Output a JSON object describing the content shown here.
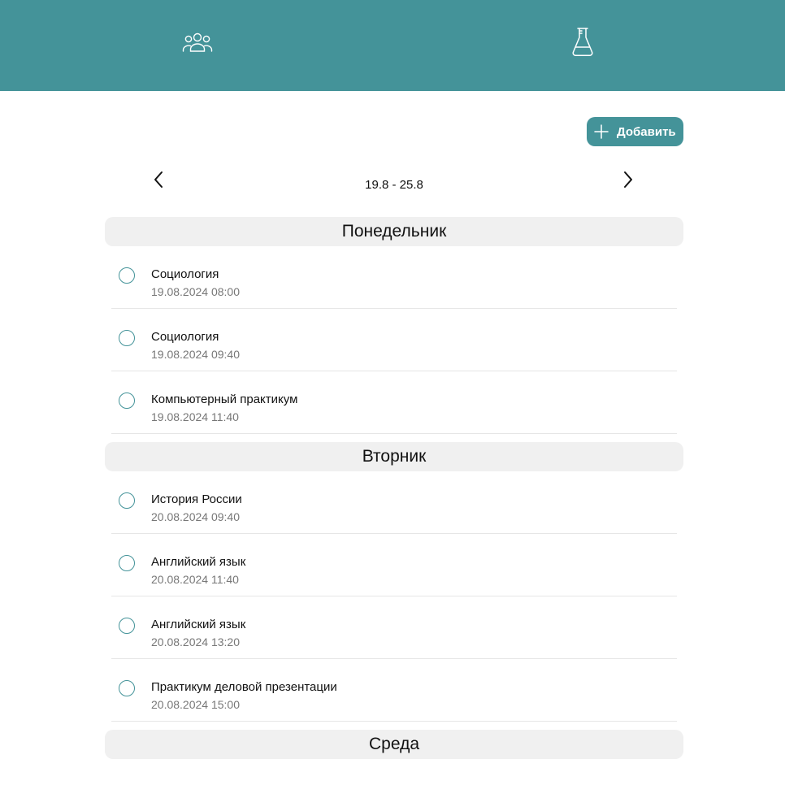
{
  "topbar": {
    "background": "#449399",
    "icons": [
      "people-icon",
      "flask-icon"
    ]
  },
  "toolbar": {
    "add_label": "Добавить"
  },
  "week": {
    "range": "19.8 - 25.8"
  },
  "days": [
    {
      "name": "Понедельник",
      "items": [
        {
          "title": "Социология",
          "time": "19.08.2024 08:00"
        },
        {
          "title": "Социология",
          "time": "19.08.2024 09:40"
        },
        {
          "title": "Компьютерный практикум",
          "time": "19.08.2024 11:40"
        }
      ]
    },
    {
      "name": "Вторник",
      "items": [
        {
          "title": "История России",
          "time": "20.08.2024 09:40"
        },
        {
          "title": "Английский язык",
          "time": "20.08.2024 11:40"
        },
        {
          "title": "Английский язык",
          "time": "20.08.2024 13:20"
        },
        {
          "title": "Практикум деловой презентации",
          "time": "20.08.2024 15:00"
        }
      ]
    },
    {
      "name": "Среда",
      "items": []
    }
  ]
}
